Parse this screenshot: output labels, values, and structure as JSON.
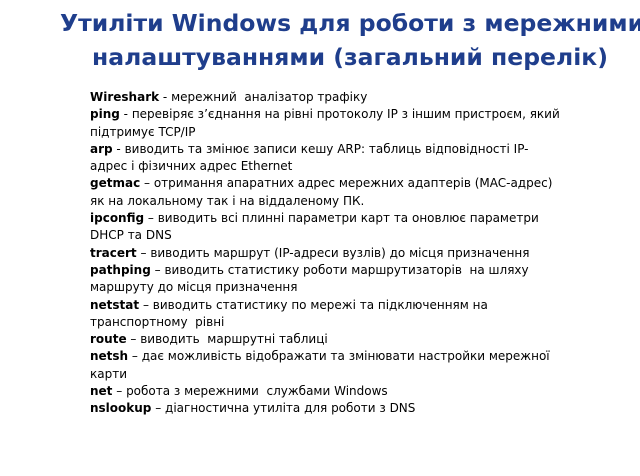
{
  "title": {
    "line1": "Утиліти Windows для роботи з мережними",
    "line2": "налаштуваннями  (загальний перелік)"
  },
  "utilities": [
    {
      "name": "Wireshark",
      "sep": " - ",
      "lines": [
        "мережний  аналізатор трафіку"
      ]
    },
    {
      "name": "ping",
      "sep": " - ",
      "lines": [
        "перевіряє з’єднання на рівні протоколу IP з іншим пристроєм, який",
        "підтримує TCP/IP"
      ]
    },
    {
      "name": "arp",
      "sep": " - ",
      "lines": [
        "виводить та змінює записи кешу ARP: таблиць відповідності IP-",
        "адрес і фізичних адрес Ethernet"
      ]
    },
    {
      "name": "getmac",
      "sep": " – ",
      "lines": [
        "отримання апаратних адрес мережних адаптерів (MAC-адрес)",
        "як на локальному так і на віддаленому ПК."
      ]
    },
    {
      "name": "ipconfig",
      "sep": " – ",
      "lines": [
        "виводить всі плинні параметри карт та оновлює параметри",
        "DHCP та DNS"
      ]
    },
    {
      "name": "tracert",
      "sep": " – ",
      "lines": [
        "виводить маршрут (IP-адреси вузлів) до місця призначення"
      ]
    },
    {
      "name": "pathping",
      "sep": " – ",
      "lines": [
        "виводить статистику роботи маршрутизаторів  на шляху",
        "маршруту до місця призначення"
      ]
    },
    {
      "name": "netstat",
      "sep": " – ",
      "lines": [
        "виводить статистику по мережі та підключенням на",
        "транспортному  рівні"
      ]
    },
    {
      "name": "route",
      "sep": " – ",
      "lines": [
        "виводить  маршрутні таблиці"
      ]
    },
    {
      "name": "netsh",
      "sep": " – ",
      "lines": [
        "дає можливість відображати та змінювати настройки мережної",
        "карти"
      ]
    },
    {
      "name": "net",
      "sep": " – ",
      "lines": [
        "робота з мережними  службами Windows"
      ]
    },
    {
      "name": "nslookup",
      "sep": " – ",
      "lines": [
        "діагностична утиліта для роботи з DNS"
      ]
    }
  ]
}
